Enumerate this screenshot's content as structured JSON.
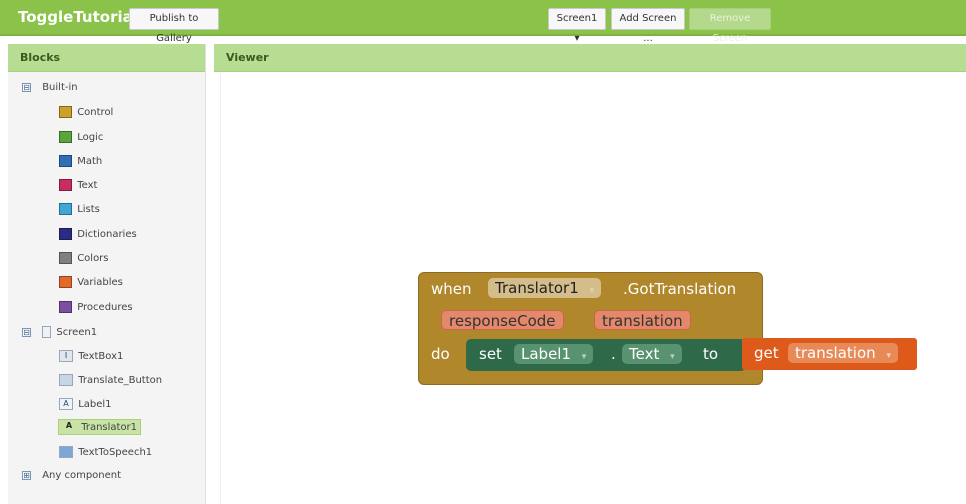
{
  "app": {
    "title": "ToggleTutorial",
    "publish_label": "Publish to Gallery",
    "screen_select": "Screen1",
    "add_screen_label": "Add Screen ...",
    "remove_screen_label": "Remove Screen"
  },
  "blocks_panel": {
    "header": "Blocks",
    "builtin_label": "Built-in",
    "builtin_items": [
      {
        "label": "Control",
        "color": "#c9a227"
      },
      {
        "label": "Logic",
        "color": "#5ba53b"
      },
      {
        "label": "Math",
        "color": "#2f6fb5"
      },
      {
        "label": "Text",
        "color": "#c72c63"
      },
      {
        "label": "Lists",
        "color": "#40a6d6"
      },
      {
        "label": "Dictionaries",
        "color": "#2b2b86"
      },
      {
        "label": "Colors",
        "color": "#808080"
      },
      {
        "label": "Variables",
        "color": "#e1692b"
      },
      {
        "label": "Procedures",
        "color": "#7b4ea1"
      }
    ],
    "screen_label": "Screen1",
    "components": [
      "TextBox1",
      "Translate_Button",
      "Label1",
      "Translator1",
      "TextToSpeech1"
    ],
    "any_component_label": "Any component",
    "toggle_expanded": "⊟",
    "toggle_collapsed": "⊞"
  },
  "viewer": {
    "header": "Viewer",
    "event": {
      "when": "when",
      "component": "Translator1",
      "event_name": ".GotTranslation",
      "param1": "responseCode",
      "param2": "translation",
      "do": "do"
    },
    "setter": {
      "set": "set",
      "component": "Label1",
      "dot": ".",
      "property": "Text",
      "to": "to"
    },
    "getter": {
      "get": "get",
      "variable": "translation"
    },
    "dropdown_glyph": "▾"
  },
  "colors": {
    "topbar": "#8bc34a",
    "panel_header": "#b7dd92",
    "event_block": "#b1872c",
    "setter_block": "#2e6a4a",
    "getter_block": "#dd5a1b"
  }
}
